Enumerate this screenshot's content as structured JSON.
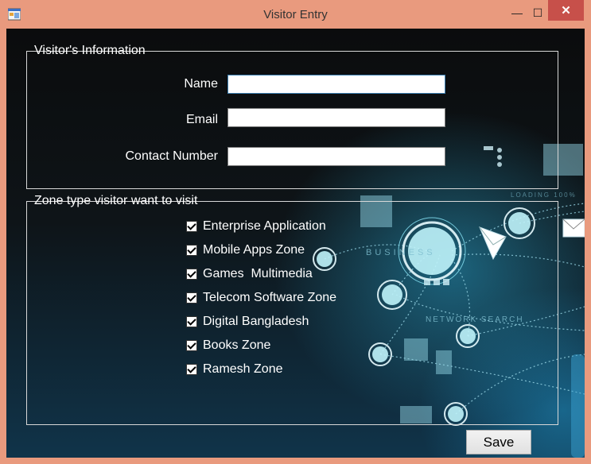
{
  "window": {
    "title": "Visitor Entry"
  },
  "visitor_info": {
    "legend": "Visitor's Information",
    "fields": [
      {
        "label": "Name",
        "value": ""
      },
      {
        "label": "Email",
        "value": ""
      },
      {
        "label": "Contact Number",
        "value": ""
      }
    ]
  },
  "zones": {
    "legend": "Zone type visitor want to visit",
    "items": [
      {
        "label": "Enterprise Application",
        "checked": true
      },
      {
        "label": "Mobile Apps Zone",
        "checked": true
      },
      {
        "label": "Games  Multimedia",
        "checked": true
      },
      {
        "label": "Telecom Software Zone",
        "checked": true
      },
      {
        "label": "Digital Bangladesh",
        "checked": true
      },
      {
        "label": "Books Zone",
        "checked": true
      },
      {
        "label": "Ramesh Zone",
        "checked": true
      }
    ]
  },
  "actions": {
    "save_label": "Save"
  },
  "background": {
    "text_business": "BUSINESS",
    "text_network": "NETWORK SEARCH",
    "text_loading": "LOADING 100%"
  }
}
